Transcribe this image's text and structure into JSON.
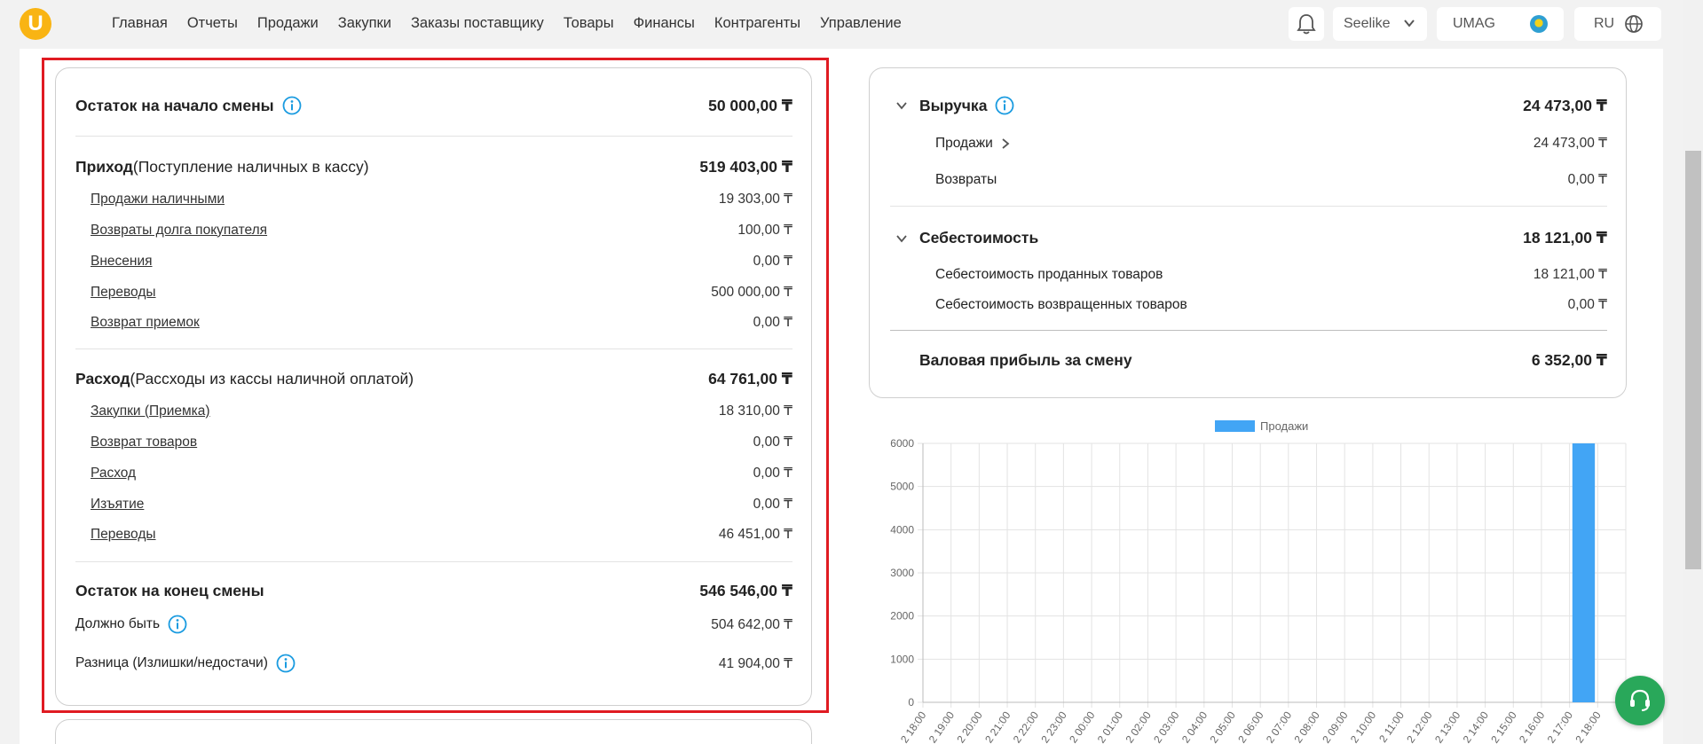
{
  "nav": {
    "items": [
      "Главная",
      "Отчеты",
      "Продажи",
      "Закупки",
      "Заказы поставщику",
      "Товары",
      "Финансы",
      "Контрагенты",
      "Управление"
    ],
    "store": "Seelike",
    "user": "UMAG",
    "lang": "RU"
  },
  "shift": {
    "opening": {
      "label": "Остаток на начало смены",
      "value": "50 000,00 ₸"
    },
    "income": {
      "label": "Приход",
      "note": " (Поступление наличных в кассу)",
      "value": "519 403,00 ₸",
      "items": [
        {
          "label": "Продажи наличными",
          "value": "19 303,00 ₸"
        },
        {
          "label": "Возвраты долга покупателя",
          "value": "100,00 ₸"
        },
        {
          "label": "Внесения",
          "value": "0,00 ₸"
        },
        {
          "label": "Переводы",
          "value": "500 000,00 ₸"
        },
        {
          "label": "Возврат приемок",
          "value": "0,00 ₸"
        }
      ]
    },
    "expense": {
      "label": "Расход",
      "note": "(Рассходы из кассы наличной оплатой)",
      "value": "64 761,00 ₸",
      "items": [
        {
          "label": "Закупки (Приемка)",
          "value": "18 310,00 ₸"
        },
        {
          "label": "Возврат товаров",
          "value": "0,00 ₸"
        },
        {
          "label": "Расход",
          "value": "0,00 ₸"
        },
        {
          "label": "Изъятие",
          "value": "0,00 ₸"
        },
        {
          "label": "Переводы",
          "value": "46 451,00 ₸"
        }
      ]
    },
    "closing": {
      "label": "Остаток на конец смены",
      "value": "546 546,00 ₸"
    },
    "expected": {
      "label": "Должно быть",
      "value": "504 642,00 ₸"
    },
    "difference": {
      "label": "Разница (Излишки/недостачи)",
      "value": "41 904,00 ₸"
    }
  },
  "revenue": {
    "label": "Выручка",
    "value": "24 473,00 ₸",
    "sales": {
      "label": "Продажи",
      "value": "24 473,00 ₸"
    },
    "returns": {
      "label": "Возвраты",
      "value": "0,00 ₸"
    }
  },
  "cost": {
    "label": "Себестоимость",
    "value": "18 121,00 ₸",
    "sold": {
      "label": "Себестоимость проданных товаров",
      "value": "18 121,00 ₸"
    },
    "returned": {
      "label": "Себестоимость возвращенных товаров",
      "value": "0,00 ₸"
    }
  },
  "gross": {
    "label": "Валовая прибыль за смену",
    "value": "6 352,00 ₸"
  },
  "colors": {
    "accent": "#1a9be0",
    "bar": "#42a5f5",
    "highlight": "#e01b22",
    "support": "#29a85a",
    "logo": "#f9b413"
  },
  "chart_data": {
    "type": "bar",
    "legend": "Продажи",
    "legend_position": "top-center",
    "grid": true,
    "ylim": [
      0,
      6000
    ],
    "yticks": [
      "0",
      "1000",
      "2000",
      "3000",
      "4000",
      "5000",
      "6000"
    ],
    "categories": [
      "18:00",
      "19:00",
      "20:00",
      "21:00",
      "22:00",
      "23:00",
      "00:00",
      "01:00",
      "02:00",
      "03:00",
      "04:00",
      "05:00",
      "06:00",
      "07:00",
      "08:00",
      "09:00",
      "10:00",
      "11:00",
      "12:00",
      "13:00",
      "14:00",
      "15:00",
      "16:00",
      "17:00",
      "18:00"
    ],
    "category_prefix": "2",
    "series": [
      {
        "name": "Продажи",
        "values": [
          0,
          0,
          0,
          0,
          0,
          0,
          0,
          0,
          0,
          0,
          0,
          0,
          0,
          0,
          0,
          0,
          0,
          0,
          0,
          0,
          0,
          0,
          0,
          6000,
          0
        ]
      }
    ]
  }
}
